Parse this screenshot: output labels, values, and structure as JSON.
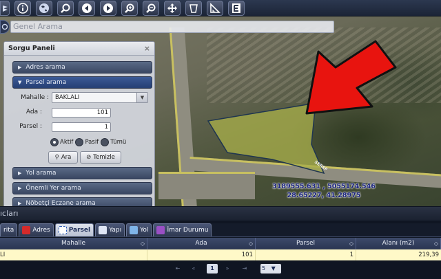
{
  "search": {
    "placeholder": "Genel Arama"
  },
  "query_panel": {
    "title": "Sorgu Paneli",
    "close": "×",
    "sections": {
      "address": "Adres arama",
      "parcel": "Parsel arama",
      "road": "Yol arama",
      "place": "Önemli Yer arama",
      "pharmacy": "Nöbetçi Eczane arama"
    },
    "form": {
      "mahalle_label": "Mahalle :",
      "mahalle_value": "BAKLALI",
      "ada_label": "Ada :",
      "ada_value": "101",
      "parsel_label": "Parsel :",
      "parsel_value": "1",
      "radio_active": "Aktif",
      "radio_passive": "Pasif",
      "radio_all": "Tümü",
      "search_btn": "Ara",
      "clear_btn": "Temizle"
    }
  },
  "map": {
    "coord_line1": "3189555.631 , 5055174.546",
    "coord_line2": "28.65227, 41.28975",
    "street": "SEREF"
  },
  "bottom": {
    "title": "ıcları",
    "tabs": [
      "rita",
      "Adres",
      "Parsel",
      "Yapı",
      "Yol",
      "İmar Durumu"
    ],
    "active_tab": "Parsel",
    "columns": [
      "Mahalle",
      "Ada",
      "Parsel",
      "Alanı (m2)"
    ],
    "rows": [
      {
        "mahalle": "LI",
        "ada": "101",
        "parsel": "1",
        "alan": "219,39"
      }
    ],
    "pager": {
      "current": "1",
      "page_size": "5"
    }
  },
  "colors": {
    "parcel_fill": "#a6ad4a",
    "arrow": "#e8140f",
    "accent": "#253f74"
  }
}
